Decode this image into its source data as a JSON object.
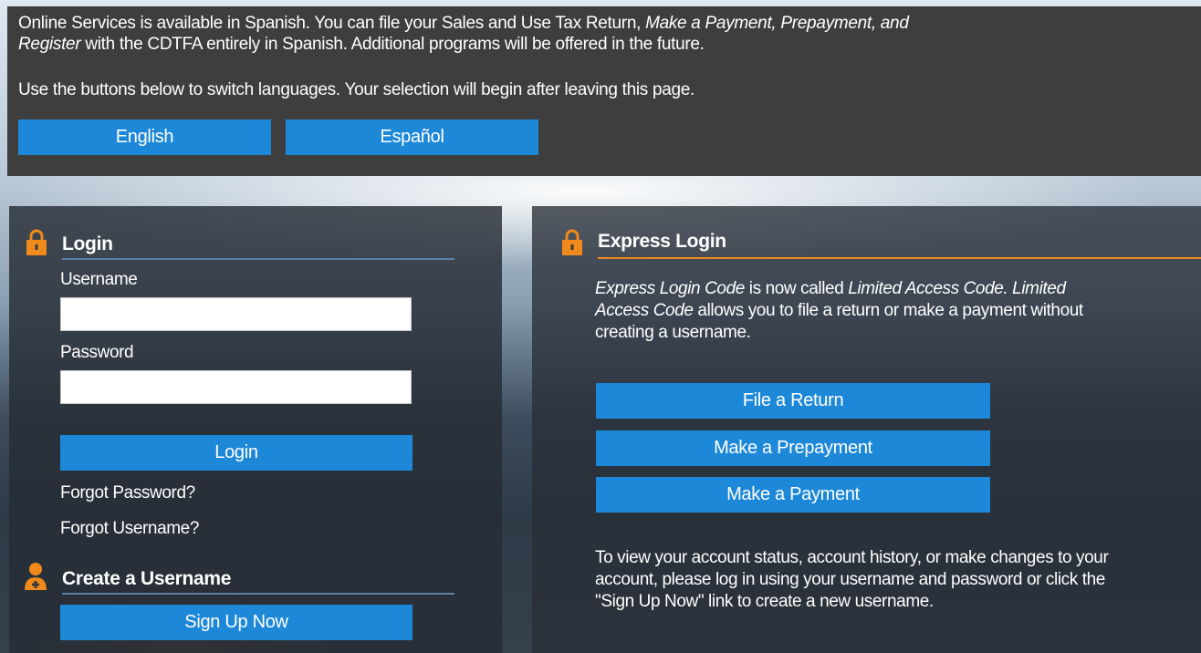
{
  "banner": {
    "line1_a": "Online Services is available in Spanish. You can file your Sales and Use Tax Return, ",
    "line1_b": "Make a Payment, Prepayment, and",
    "line2_a": "Register",
    "line2_b": " with the CDTFA entirely in Spanish. Additional programs will be offered in the future.",
    "line3": "Use the buttons below to switch languages. Your selection will begin after leaving this page.",
    "english_label": "English",
    "spanish_label": "Español"
  },
  "login": {
    "heading": "Login",
    "username_label": "Username",
    "username_value": "",
    "password_label": "Password",
    "password_value": "",
    "login_button": "Login",
    "forgot_password": "Forgot Password?",
    "forgot_username": "Forgot Username?"
  },
  "create": {
    "heading": "Create a Username",
    "signup_button": "Sign Up Now"
  },
  "express": {
    "heading": "Express Login",
    "p1_l1_a": "Express Login Code",
    "p1_l1_b": " is now called ",
    "p1_l1_c": "Limited Access Code. Limited",
    "p1_l2_a": "Access Code",
    "p1_l2_b": " allows you to file a return or make a payment without",
    "p1_l3": "creating a username.",
    "file_return": "File a Return",
    "make_prepayment": "Make a Prepayment",
    "make_payment": "Make a Payment",
    "p2_l1": "To view your account status, account history, or make changes to your",
    "p2_l2": "account, please log in using your username and password or click the",
    "p2_l3": "\"Sign Up Now\" link to create a new username."
  },
  "colors": {
    "accent_blue": "#1e88d8",
    "icon_orange": "#f08a1c",
    "banner_bg": "#3e3e3e"
  },
  "icons": [
    "lock-icon",
    "person-icon"
  ]
}
